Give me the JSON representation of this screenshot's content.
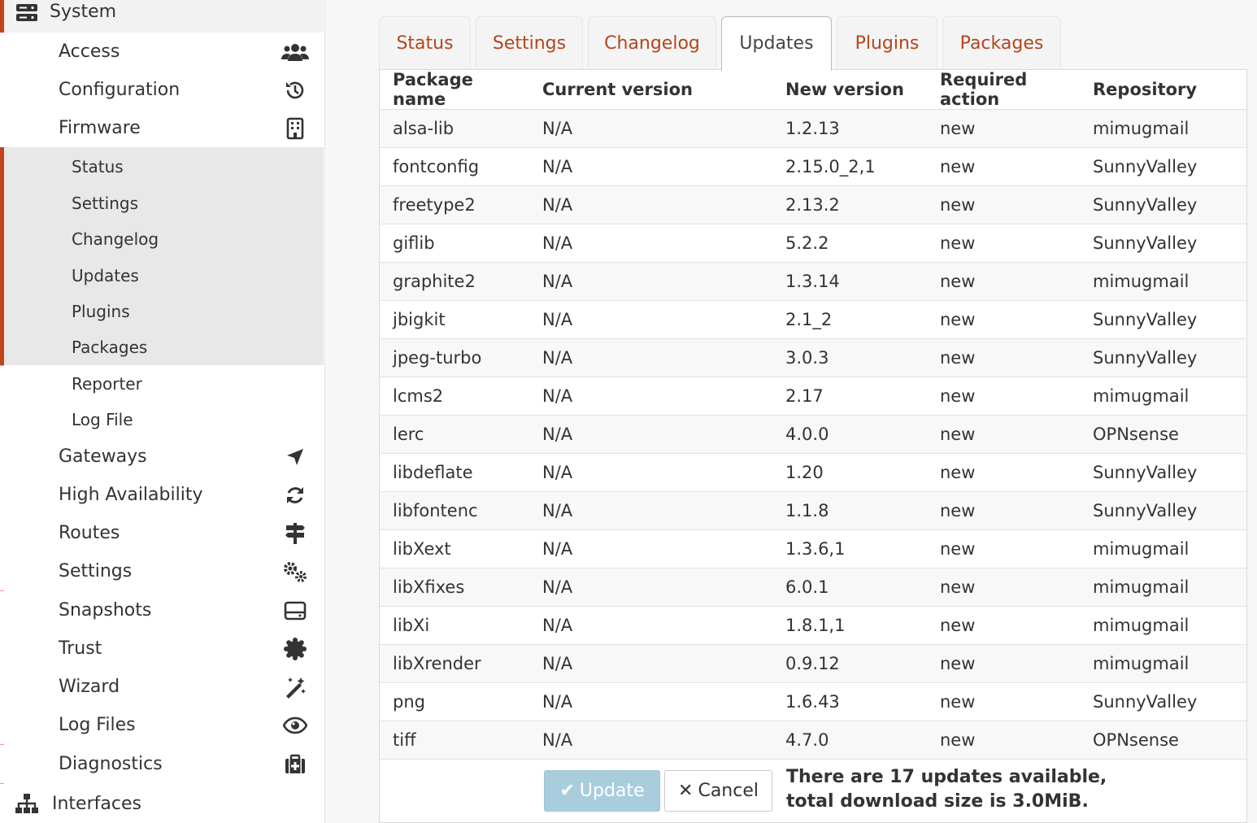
{
  "sidebar": {
    "section_label": "System",
    "section_icon": "server-icon",
    "items_top": [
      {
        "label": "Access",
        "icon": "users-icon"
      },
      {
        "label": "Configuration",
        "icon": "history-icon"
      },
      {
        "label": "Firmware",
        "icon": "building-icon"
      }
    ],
    "firmware_sub": [
      {
        "label": "Status"
      },
      {
        "label": "Settings"
      },
      {
        "label": "Changelog"
      },
      {
        "label": "Updates"
      },
      {
        "label": "Plugins"
      },
      {
        "label": "Packages"
      }
    ],
    "items_more_sub": [
      {
        "label": "Reporter"
      },
      {
        "label": "Log File"
      }
    ],
    "items_bottom": [
      {
        "label": "Gateways",
        "icon": "location-arrow-icon"
      },
      {
        "label": "High Availability",
        "icon": "refresh-icon"
      },
      {
        "label": "Routes",
        "icon": "signpost-icon"
      },
      {
        "label": "Settings",
        "icon": "cogs-icon"
      },
      {
        "label": "Snapshots",
        "icon": "hdd-icon"
      },
      {
        "label": "Trust",
        "icon": "certificate-icon"
      },
      {
        "label": "Wizard",
        "icon": "magic-wand-icon"
      },
      {
        "label": "Log Files",
        "icon": "eye-icon"
      },
      {
        "label": "Diagnostics",
        "icon": "medkit-icon"
      }
    ],
    "next_section_label": "Interfaces",
    "next_section_icon": "sitemap-icon",
    "accent_color": "#c0451f"
  },
  "tabs": [
    {
      "label": "Status",
      "active": false
    },
    {
      "label": "Settings",
      "active": false
    },
    {
      "label": "Changelog",
      "active": false
    },
    {
      "label": "Updates",
      "active": true
    },
    {
      "label": "Plugins",
      "active": false
    },
    {
      "label": "Packages",
      "active": false
    }
  ],
  "table": {
    "headers": [
      "Package name",
      "Current version",
      "New version",
      "Required action",
      "Repository"
    ],
    "rows": [
      [
        "alsa-lib",
        "N/A",
        "1.2.13",
        "new",
        "mimugmail"
      ],
      [
        "fontconfig",
        "N/A",
        "2.15.0_2,1",
        "new",
        "SunnyValley"
      ],
      [
        "freetype2",
        "N/A",
        "2.13.2",
        "new",
        "SunnyValley"
      ],
      [
        "giflib",
        "N/A",
        "5.2.2",
        "new",
        "SunnyValley"
      ],
      [
        "graphite2",
        "N/A",
        "1.3.14",
        "new",
        "mimugmail"
      ],
      [
        "jbigkit",
        "N/A",
        "2.1_2",
        "new",
        "SunnyValley"
      ],
      [
        "jpeg-turbo",
        "N/A",
        "3.0.3",
        "new",
        "SunnyValley"
      ],
      [
        "lcms2",
        "N/A",
        "2.17",
        "new",
        "mimugmail"
      ],
      [
        "lerc",
        "N/A",
        "4.0.0",
        "new",
        "OPNsense"
      ],
      [
        "libdeflate",
        "N/A",
        "1.20",
        "new",
        "SunnyValley"
      ],
      [
        "libfontenc",
        "N/A",
        "1.1.8",
        "new",
        "SunnyValley"
      ],
      [
        "libXext",
        "N/A",
        "1.3.6,1",
        "new",
        "mimugmail"
      ],
      [
        "libXfixes",
        "N/A",
        "6.0.1",
        "new",
        "mimugmail"
      ],
      [
        "libXi",
        "N/A",
        "1.8.1,1",
        "new",
        "mimugmail"
      ],
      [
        "libXrender",
        "N/A",
        "0.9.12",
        "new",
        "mimugmail"
      ],
      [
        "png",
        "N/A",
        "1.6.43",
        "new",
        "SunnyValley"
      ],
      [
        "tiff",
        "N/A",
        "4.7.0",
        "new",
        "OPNsense"
      ]
    ]
  },
  "footer": {
    "update_label": "Update",
    "cancel_label": "Cancel",
    "summary_line1": "There are 17 updates available,",
    "summary_line2": "total download size is 3.0MiB."
  }
}
